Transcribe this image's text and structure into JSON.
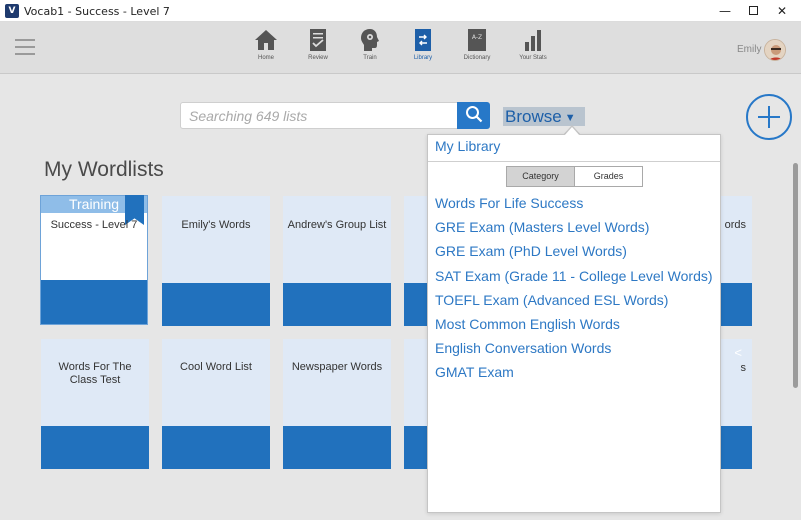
{
  "window": {
    "app_icon": "V",
    "title": "Vocab1 - Success - Level 7",
    "minimize": "—",
    "close": "✕"
  },
  "nav": {
    "items": [
      {
        "label": "Home",
        "icon": "home-icon"
      },
      {
        "label": "Review",
        "icon": "review-icon"
      },
      {
        "label": "Train",
        "icon": "train-icon"
      },
      {
        "label": "Library",
        "icon": "library-icon"
      },
      {
        "label": "Dictionary",
        "icon": "dictionary-icon"
      },
      {
        "label": "Your Stats",
        "icon": "stats-icon"
      }
    ],
    "active": "Library",
    "dictionary_glyph": "A-Z",
    "user_name": "Emily"
  },
  "search": {
    "placeholder": "Searching 649 lists",
    "value": ""
  },
  "browse": {
    "label": "Browse",
    "caret": "▼"
  },
  "main": {
    "title": "My Wordlists",
    "cards": [
      {
        "name": "Success - Level 7",
        "badge": "Training",
        "selected": true
      },
      {
        "name": "Emily's Words"
      },
      {
        "name": "Andrew's Group List"
      },
      {
        "name": "Words For The Class Test"
      },
      {
        "name": "Cool Word List"
      },
      {
        "name": "Newspaper Words"
      }
    ],
    "partial_cards": {
      "row1_tail": "ords",
      "row2_tail": "s"
    },
    "share_glyph": "<"
  },
  "dropdown": {
    "header": "My Library",
    "tabs": [
      "Category",
      "Grades"
    ],
    "selected_tab": "Category",
    "categories": [
      "Words For Life Success",
      "GRE Exam (Masters Level Words)",
      "GRE Exam (PhD Level Words)",
      "SAT Exam (Grade 11 - College Level Words)",
      "TOEFL Exam (Advanced ESL Words)",
      "Most Common English Words",
      "English Conversation Words",
      "GMAT Exam"
    ]
  },
  "colors": {
    "accent": "#2778c8",
    "card_bar": "#2171bd",
    "card_bg": "#dfe9f6",
    "link": "#2d78c4"
  }
}
